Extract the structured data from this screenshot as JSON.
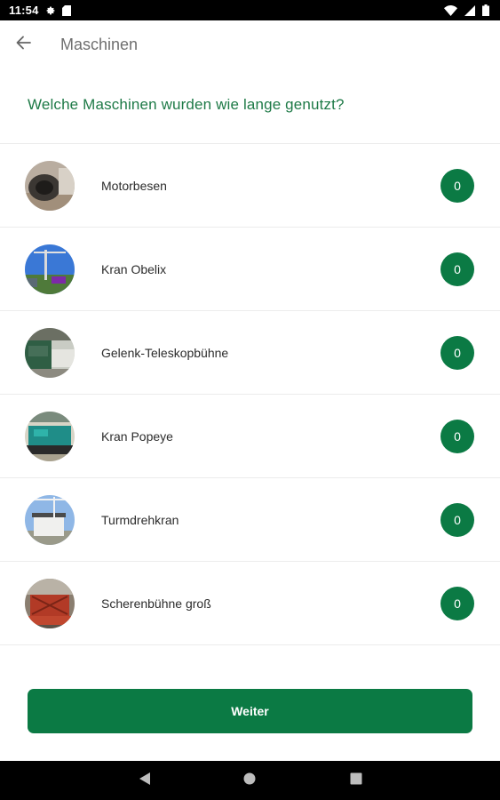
{
  "status_bar": {
    "time": "11:54",
    "icons": [
      "settings-icon",
      "sim-card-icon",
      "wifi-icon",
      "cellular-icon",
      "battery-icon"
    ]
  },
  "app_bar": {
    "back_icon": "arrow-back-icon",
    "title": "Maschinen"
  },
  "question": "Welche Maschinen wurden wie lange genutzt?",
  "machines": [
    {
      "label": "Motorbesen",
      "count": "0"
    },
    {
      "label": "Kran Obelix",
      "count": "0"
    },
    {
      "label": "Gelenk-Teleskopbühne",
      "count": "0"
    },
    {
      "label": "Kran Popeye",
      "count": "0"
    },
    {
      "label": "Turmdrehkran",
      "count": "0"
    },
    {
      "label": "Scherenbühne groß",
      "count": "0"
    }
  ],
  "next_button": {
    "label": "Weiter"
  },
  "nav_bar": {
    "icons": [
      "back-triangle-icon",
      "home-circle-icon",
      "recents-square-icon"
    ]
  },
  "colors": {
    "accent": "#0b7a44",
    "question_text": "#1e7a47",
    "divider": "#ececec",
    "title_text": "#6f6f6f"
  }
}
